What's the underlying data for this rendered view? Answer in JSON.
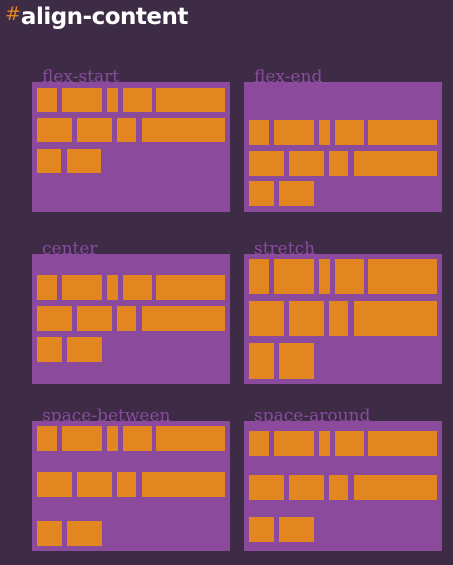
{
  "header": {
    "hash": "#",
    "title": "align-content"
  },
  "colors": {
    "background": "#3e2c46",
    "container": "#8b4a9c",
    "item": "#e2861f",
    "label": "#8a4aa0"
  },
  "examples": [
    {
      "label": "flex-start"
    },
    {
      "label": "flex-end"
    },
    {
      "label": "center"
    },
    {
      "label": "stretch"
    },
    {
      "label": "space-between"
    },
    {
      "label": "space-around"
    }
  ]
}
